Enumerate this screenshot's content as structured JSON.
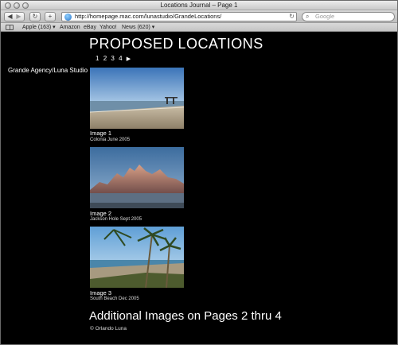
{
  "window": {
    "title": "Locations Journal – Page 1"
  },
  "toolbar": {
    "back_icon": "back-arrow-icon",
    "forward_icon": "forward-arrow-icon",
    "reload_icon": "reload-icon",
    "add_icon": "plus-icon",
    "address_value": "http://homepage.mac.com/lunastudio/GrandeLocations/",
    "search_placeholder": "Google"
  },
  "bookmarks": {
    "items": [
      {
        "label": "Apple (163) ▾"
      },
      {
        "label": "Amazon"
      },
      {
        "label": "eBay"
      },
      {
        "label": "Yahoo!"
      },
      {
        "label": "News (620) ▾"
      }
    ]
  },
  "page": {
    "heading": "PROPOSED LOCATIONS",
    "pager": {
      "pages": [
        "1",
        "2",
        "3",
        "4"
      ],
      "next": "▶"
    },
    "site_name": "Grande Agency/Luna Studio",
    "images": [
      {
        "title": "Image 1",
        "subtitle": "Colonia June 2005"
      },
      {
        "title": "Image 2",
        "subtitle": "Jackson Hole Sept 2005"
      },
      {
        "title": "Image 3",
        "subtitle": "South Beach Dec 2005"
      }
    ],
    "more_note": "Additional Images on Pages 2 thru 4",
    "copyright": "© Orlando Luna"
  }
}
